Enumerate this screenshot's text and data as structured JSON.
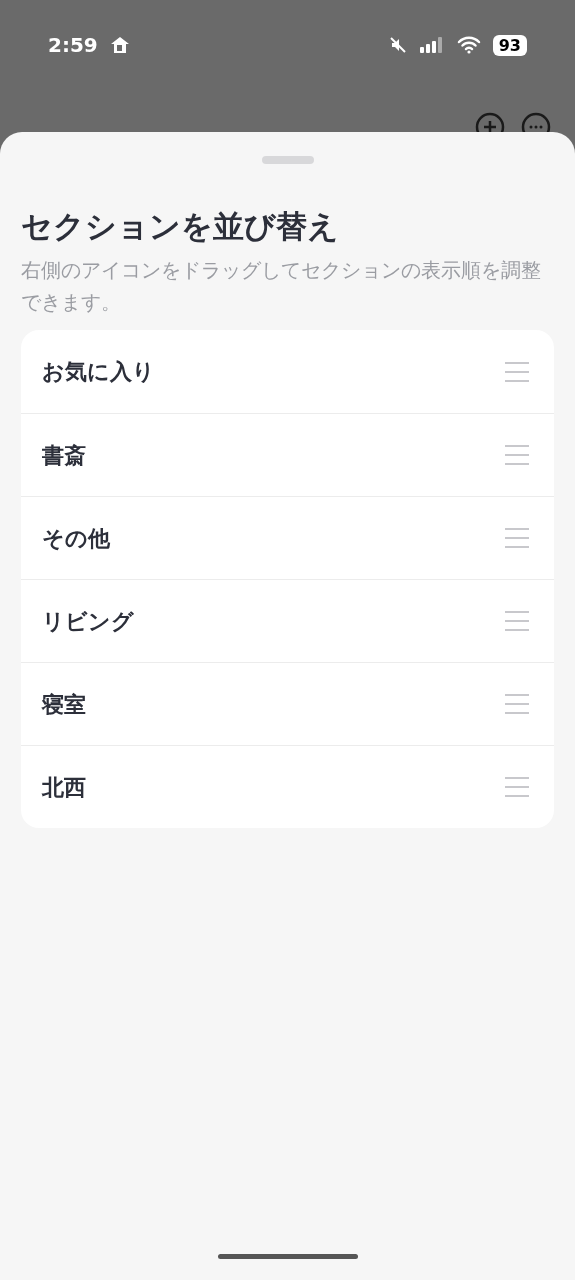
{
  "status_bar": {
    "time": "2:59",
    "battery": "93"
  },
  "sheet": {
    "title": "セクションを並び替え",
    "description": "右側のアイコンをドラッグしてセクションの表示順を調整できます。",
    "sections": [
      {
        "label": "お気に入り"
      },
      {
        "label": "書斎"
      },
      {
        "label": "その他"
      },
      {
        "label": "リビング"
      },
      {
        "label": "寝室"
      },
      {
        "label": "北西"
      }
    ]
  }
}
